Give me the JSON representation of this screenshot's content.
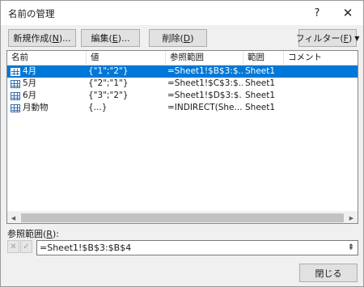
{
  "window": {
    "title": "名前の管理",
    "help_glyph": "?",
    "close_glyph": "✕"
  },
  "toolbar": {
    "new_label": "新規作成(",
    "new_key": "N",
    "new_suffix": ")...",
    "edit_label": "編集(",
    "edit_key": "E",
    "edit_suffix": ")...",
    "delete_label": "削除(",
    "delete_key": "D",
    "delete_suffix": ")",
    "filter_label": "フィルター(",
    "filter_key": "F",
    "filter_suffix": ")",
    "filter_arrow": "▼"
  },
  "list": {
    "columns": [
      "名前",
      "値",
      "参照範囲",
      "範囲",
      "コメント"
    ],
    "rows": [
      {
        "name": "4月",
        "value": "{\"1\";\"2\"}",
        "ref": "=Sheet1!$B$3:$...",
        "scope": "Sheet1",
        "comment": "",
        "selected": true
      },
      {
        "name": "5月",
        "value": "{\"2\";\"1\"}",
        "ref": "=Sheet1!$C$3:$...",
        "scope": "Sheet1",
        "comment": "",
        "selected": false
      },
      {
        "name": "6月",
        "value": "{\"3\";\"2\"}",
        "ref": "=Sheet1!$D$3:$...",
        "scope": "Sheet1",
        "comment": "",
        "selected": false
      },
      {
        "name": "月動物",
        "value": "{...}",
        "ref": "=INDIRECT(She...",
        "scope": "Sheet1",
        "comment": "",
        "selected": false
      }
    ],
    "scroll_left": "◀",
    "scroll_right": "▶"
  },
  "refers_to": {
    "label": "参照範囲(",
    "key": "R",
    "suffix": "):",
    "cancel_glyph": "✕",
    "ok_glyph": "✓",
    "value": "=Sheet1!$B$3:$B$4",
    "collapse_glyph": "⇞"
  },
  "footer": {
    "close_label": "閉じる"
  },
  "colors": {
    "selection": "#0078d7",
    "dialog_bg": "#f0f0f0"
  }
}
